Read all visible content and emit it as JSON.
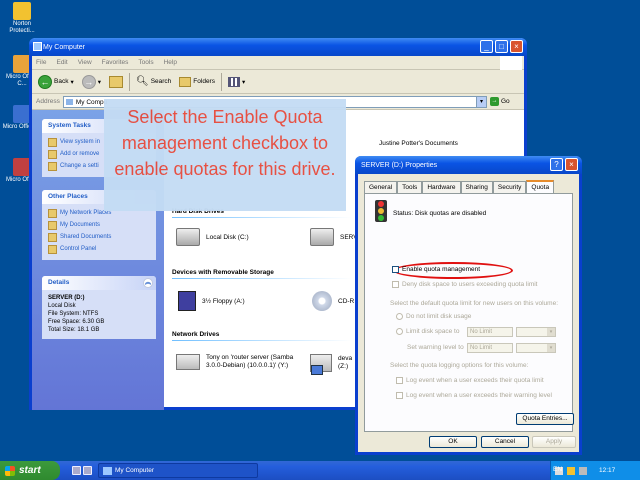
{
  "desktop": {
    "icons": [
      {
        "label": "Norton Protecti..."
      },
      {
        "label": "Micro Office C..."
      },
      {
        "label": "Micro Office ..."
      },
      {
        "label": "Micro Office"
      }
    ]
  },
  "explorer": {
    "title": "My Computer",
    "menu": [
      "File",
      "Edit",
      "View",
      "Favorites",
      "Tools",
      "Help"
    ],
    "toolbar": {
      "back": "Back",
      "search": "Search",
      "folders": "Folders"
    },
    "address_label": "Address",
    "address_value": "My Compu",
    "go": "Go",
    "system_tasks": {
      "title": "System Tasks",
      "items": [
        "View system in",
        "Add or remove",
        "Change a setti"
      ]
    },
    "other_places": {
      "title": "Other Places",
      "items": [
        "My Network Places",
        "My Documents",
        "Shared Documents",
        "Control Panel"
      ]
    },
    "details": {
      "title": "Details",
      "name": "SERVER (D:)",
      "type": "Local Disk",
      "fs": "File System: NTFS",
      "free": "Free Space: 6.30 GB",
      "total": "Total Size: 18.1 GB"
    },
    "docs_item": "Justine Potter's Documents",
    "sections": {
      "hdd": "Hard Disk Drives",
      "removable": "Devices with Removable Storage",
      "network": "Network Drives"
    },
    "items": {
      "local_c": "Local Disk (C:)",
      "server": "SERVER",
      "floppy": "3½ Floppy (A:)",
      "cd": "CD-R",
      "tony": "Tony on 'router server (Samba 3.0.0-Debian) (10.0.0.1)' (Y:)",
      "dev": "deva",
      "dev2": "(Z:)"
    }
  },
  "callout": {
    "text_a": "Select the ",
    "text_b": "Enable Quota management",
    "text_c": " checkbox to enable quotas for this drive."
  },
  "props": {
    "title": "SERVER (D:) Properties",
    "tabs": [
      "General",
      "Tools",
      "Hardware",
      "Sharing",
      "Security",
      "Quota"
    ],
    "status": "Status:  Disk quotas are disabled",
    "enable_quota": "Enable quota management",
    "deny": "Deny disk space to users exceeding quota limit",
    "select_default": "Select the default quota limit for new users on this volume:",
    "do_not_limit": "Do not limit disk usage",
    "limit_to": "Limit disk space to",
    "warning": "Set warning level to",
    "no_limit": "No Limit",
    "logging": "Select the quota logging options for this volume:",
    "log1": "Log event when a user exceeds their quota limit",
    "log2": "Log event when a user exceeds their warning level",
    "quota_entries": "Quota Entries...",
    "ok": "OK",
    "cancel": "Cancel",
    "apply": "Apply"
  },
  "taskbar": {
    "start": "start",
    "task": "My Computer",
    "lang": "EN",
    "clock": "12:17"
  }
}
